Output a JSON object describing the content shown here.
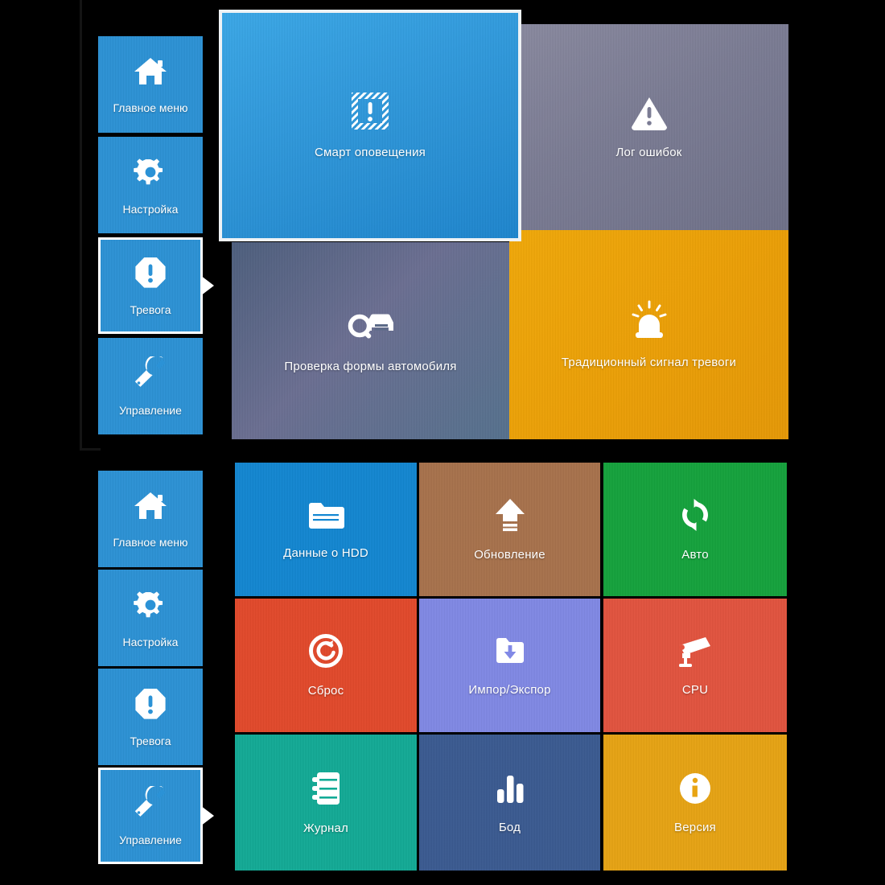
{
  "panels": {
    "top": {
      "sidebar": [
        {
          "label": "Главное меню",
          "icon": "home-icon",
          "selected": false
        },
        {
          "label": "Настройка",
          "icon": "gear-icon",
          "selected": false
        },
        {
          "label": "Тревога",
          "icon": "alarm-octagon-icon",
          "selected": true
        },
        {
          "label": "Управление",
          "icon": "wrench-icon",
          "selected": false
        }
      ],
      "tiles": [
        {
          "label": "Смарт оповещения",
          "icon": "smart-alert-icon",
          "color": "#2f9ee0",
          "selected": true
        },
        {
          "label": "Лог ошибок",
          "icon": "warning-triangle-icon",
          "color": "#7d7e95",
          "selected": false
        },
        {
          "label": "Проверка формы автомобиля",
          "icon": "car-search-icon",
          "color": "#5a6780",
          "selected": false
        },
        {
          "label": "Традиционный сигнал тревоги",
          "icon": "siren-icon",
          "color": "#efa006",
          "selected": false
        }
      ]
    },
    "bottom": {
      "sidebar": [
        {
          "label": "Главное меню",
          "icon": "home-icon",
          "selected": false
        },
        {
          "label": "Настройка",
          "icon": "gear-icon",
          "selected": false
        },
        {
          "label": "Тревога",
          "icon": "alarm-octagon-icon",
          "selected": false
        },
        {
          "label": "Управление",
          "icon": "wrench-icon",
          "selected": true
        }
      ],
      "tiles": [
        {
          "label": "Данные о HDD",
          "icon": "folder-icon",
          "color": "#1287d2"
        },
        {
          "label": "Обновление",
          "icon": "upload-arrow-icon",
          "color": "#a8724c"
        },
        {
          "label": "Авто",
          "icon": "refresh-icon",
          "color": "#14a33c"
        },
        {
          "label": "Сброс",
          "icon": "reset-circle-icon",
          "color": "#e3492a"
        },
        {
          "label": "Импор/Экспор",
          "icon": "folder-download-icon",
          "color": "#8189e6"
        },
        {
          "label": "CPU",
          "icon": "camera-icon",
          "color": "#e3533e"
        },
        {
          "label": "Журнал",
          "icon": "log-book-icon",
          "color": "#12ab96"
        },
        {
          "label": "Бод",
          "icon": "bar-chart-icon",
          "color": "#3a5a91"
        },
        {
          "label": "Версия",
          "icon": "info-circle-icon",
          "color": "#e8a413"
        }
      ]
    }
  },
  "colors": {
    "sidebar_blue": "#2b92d6",
    "selection_border": "#ffffff",
    "background": "#000000"
  }
}
